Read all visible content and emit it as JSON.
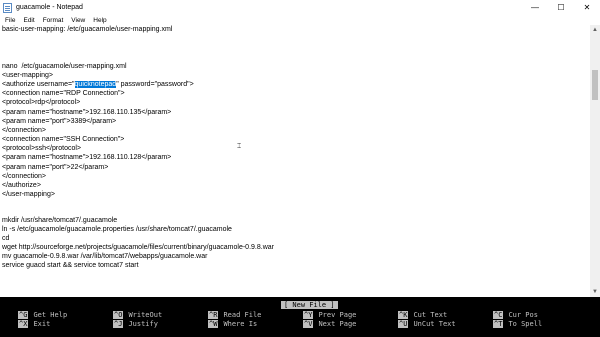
{
  "window": {
    "title": "guacamole - Notepad",
    "minimize_glyph": "—",
    "maximize_glyph": "☐",
    "close_glyph": "✕"
  },
  "menu": [
    "File",
    "Edit",
    "Format",
    "View",
    "Help"
  ],
  "editor": {
    "lines": [
      "basic-user-mapping: /etc/guacamole/user-mapping.xml",
      "",
      "",
      "",
      "nano  /etc/guacamole/user-mapping.xml",
      "<user-mapping>",
      "",
      "<connection name=\"RDP Connection\">",
      "<protocol>rdp</protocol>",
      "<param name=\"hostname\">192.168.110.135</param>",
      "<param name=\"port\">3389</param>",
      "</connection>",
      "<connection name=\"SSH Connection\">",
      "<protocol>ssh</protocol>",
      "<param name=\"hostname\">192.168.110.128</param>",
      "<param name=\"port\">22</param>",
      "</connection>",
      "</authorize>",
      "</user-mapping>",
      "",
      "mkdir /usr/share/tomcat7/.guacamole",
      "ln -s /etc/guacamole/guacamole.properties /usr/share/tomcat7/.guacamole",
      "cd",
      "wget http://sourceforge.net/projects/guacamole/files/current/binary/guacamole-0.9.8.war",
      "mv guacamole-0.9.8.war /var/lib/tomcat7/webapps/guacamole.war",
      "service guacd start && service tomcat7 start"
    ],
    "authorize_prefix": "<authorize username=\"",
    "authorize_selected": "quicknotepad",
    "authorize_suffix": "\" password=\"password\">"
  },
  "nano": {
    "status": "[ New File ]",
    "shortcuts_row1": [
      {
        "key": "^G",
        "label": "Get Help"
      },
      {
        "key": "^O",
        "label": "WriteOut"
      },
      {
        "key": "^R",
        "label": "Read File"
      },
      {
        "key": "^Y",
        "label": "Prev Page"
      },
      {
        "key": "^K",
        "label": "Cut Text"
      },
      {
        "key": "^C",
        "label": "Cur Pos"
      }
    ],
    "shortcuts_row2": [
      {
        "key": "^X",
        "label": "Exit"
      },
      {
        "key": "^J",
        "label": "Justify"
      },
      {
        "key": "^W",
        "label": "Where Is"
      },
      {
        "key": "^V",
        "label": "Next Page"
      },
      {
        "key": "^U",
        "label": "UnCut Text"
      },
      {
        "key": "^T",
        "label": "To Spell"
      }
    ]
  }
}
